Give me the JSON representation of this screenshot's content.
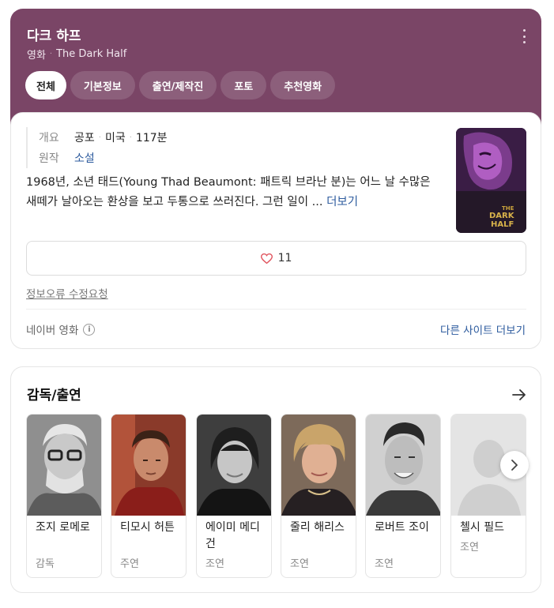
{
  "header": {
    "title": "다크 하프",
    "category": "영화",
    "original_title": "The Dark Half",
    "bg_color": "#7a4566"
  },
  "tabs": [
    {
      "label": "전체",
      "active": true
    },
    {
      "label": "기본정보"
    },
    {
      "label": "출연/제작진"
    },
    {
      "label": "포토"
    },
    {
      "label": "추천영화"
    }
  ],
  "overview": {
    "label_summary": "개요",
    "genre": "공포",
    "country": "미국",
    "runtime": "117분",
    "label_original": "원작",
    "original": "소설"
  },
  "description": {
    "text": "1968년, 소년 태드(Young Thad Beaumont: 패트릭 브라난 분)는 어느 날 수많은 새떼가 날아오는 환상을 보고 두통으로 쓰러진다. 그런 일이 ... ",
    "more_label": "더보기"
  },
  "like": {
    "icon": "heart-icon",
    "count": "11"
  },
  "report_label": "정보오류 수정요청",
  "source_label": "네이버 영화",
  "other_sites_label": "다른 사이트 더보기",
  "cast_section": {
    "title": "감독/출연",
    "people": [
      {
        "name": "조지 로메로",
        "role": "감독"
      },
      {
        "name": "티모시 허튼",
        "role": "주연"
      },
      {
        "name": "에이미 메디건",
        "role": "조연"
      },
      {
        "name": "줄리 해리스",
        "role": "조연"
      },
      {
        "name": "로버트 조이",
        "role": "조연"
      },
      {
        "name": "첼시 필드",
        "role": "조연"
      }
    ]
  },
  "colors": {
    "link": "#2d5b9e",
    "heart": "#e0535d"
  }
}
